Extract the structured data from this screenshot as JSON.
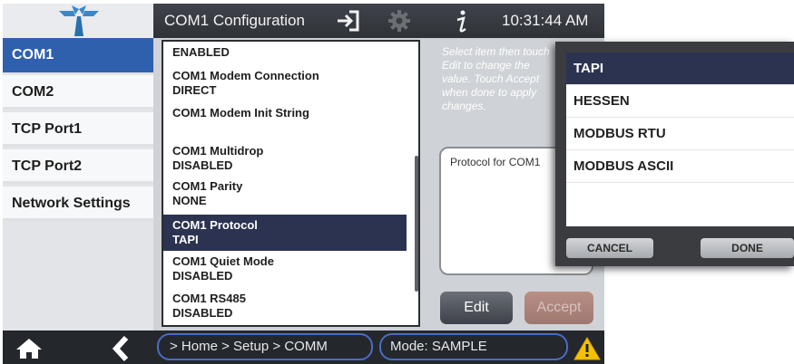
{
  "header": {
    "title": "COM1 Configuration",
    "time": "10:31:44 AM",
    "icons": [
      "logo-icon",
      "exit-icon",
      "gear-icon",
      "info-icon"
    ]
  },
  "nav": {
    "items": [
      {
        "label": "COM1",
        "active": true
      },
      {
        "label": "COM2",
        "active": false
      },
      {
        "label": "TCP Port1",
        "active": false
      },
      {
        "label": "TCP Port2",
        "active": false
      },
      {
        "label": "Network Settings",
        "active": false
      }
    ]
  },
  "list": {
    "rows": [
      {
        "name": "",
        "value": "ENABLED"
      },
      {
        "name": "COM1 Modem Connection",
        "value": "DIRECT"
      },
      {
        "name": "COM1 Modem Init String",
        "value": ""
      },
      {
        "name": "COM1 Multidrop",
        "value": "DISABLED"
      },
      {
        "name": "COM1 Parity",
        "value": "NONE"
      },
      {
        "name": "COM1 Protocol",
        "value": "TAPI",
        "selected": true
      },
      {
        "name": "COM1 Quiet Mode",
        "value": "DISABLED"
      },
      {
        "name": "COM1 RS485",
        "value": "DISABLED"
      }
    ]
  },
  "right": {
    "hint": "Select item then touch Edit to change the value. Touch Accept when done to apply changes.",
    "protocol_label": "Protocol for COM1",
    "edit_label": "Edit",
    "accept_label": "Accept"
  },
  "footer": {
    "breadcrumb": "> Home > Setup > COMM",
    "mode": "Mode: SAMPLE"
  },
  "popup": {
    "options": [
      {
        "label": "TAPI",
        "selected": true
      },
      {
        "label": "HESSEN",
        "selected": false
      },
      {
        "label": "MODBUS RTU",
        "selected": false
      },
      {
        "label": "MODBUS ASCII",
        "selected": false
      }
    ],
    "cancel_label": "CANCEL",
    "done_label": "DONE"
  },
  "colors": {
    "accent": "#2f60ad",
    "selection": "#2c3351",
    "warning": "#f2c200"
  }
}
